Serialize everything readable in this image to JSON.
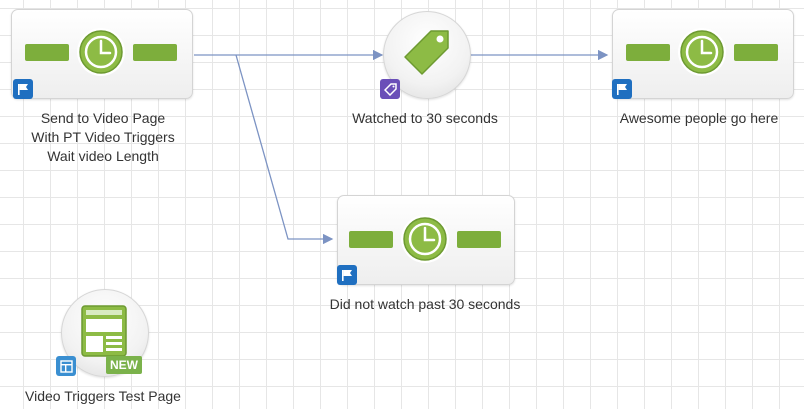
{
  "canvas": {
    "grid_color": "#e6e6e6",
    "connector_color": "#7c93c3"
  },
  "nodes": {
    "send_video": {
      "label": "Send to Video Page\nWith PT Video Triggers\nWait video Length",
      "icon": "wait-timer-icon",
      "badge_icon": "flag-icon"
    },
    "watched": {
      "label": "Watched to 30 seconds",
      "icon": "tag-icon",
      "badge_icon": "tag-badge-icon"
    },
    "awesome": {
      "label": "Awesome people go here",
      "icon": "wait-timer-icon",
      "badge_icon": "flag-icon"
    },
    "not_watched": {
      "label": "Did not watch past 30 seconds",
      "icon": "wait-timer-icon",
      "badge_icon": "flag-icon"
    },
    "test_page": {
      "label": "Video Triggers Test Page",
      "icon": "landing-page-icon",
      "badge_icon": "page-badge-icon",
      "new_label": "NEW"
    }
  },
  "colors": {
    "timer_green": "#7dae3c",
    "badge_blue": "#1f6fc0",
    "badge_purple": "#6a4fb8",
    "new_green": "#7bb24b"
  }
}
